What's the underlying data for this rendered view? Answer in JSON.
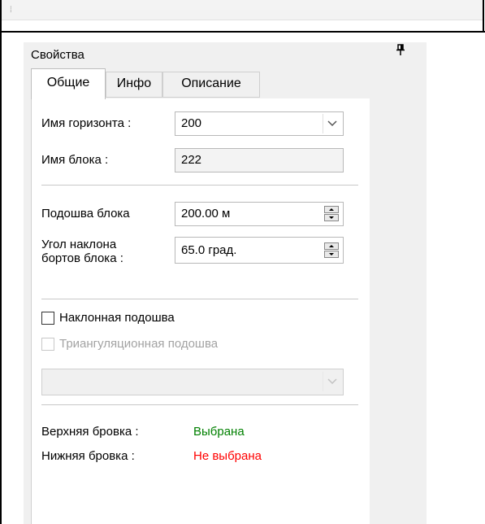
{
  "panel": {
    "title": "Свойства",
    "pin_icon": "pin-icon"
  },
  "tabs": [
    {
      "label": "Общие",
      "active": true
    },
    {
      "label": "Инфо",
      "active": false
    },
    {
      "label": "Описание",
      "active": false
    }
  ],
  "general": {
    "horizon_label": "Имя горизонта :",
    "horizon_value": "200",
    "block_label": "Имя блока :",
    "block_value": "222",
    "sole_label": "Подошва блока",
    "sole_value": "200.00 м",
    "slope_label_line1": "Угол наклона",
    "slope_label_line2": "бортов блока :",
    "slope_value": "65.0 град.",
    "inclined_label": "Наклонная подошва",
    "inclined_checked": false,
    "triang_label": "Триангуляционная  подошва",
    "triang_checked": false,
    "triang_enabled": false,
    "surface_select_value": "",
    "upper_edge_label": "Верхняя бровка :",
    "upper_edge_status": "Выбрана",
    "lower_edge_label": "Нижняя бровка :",
    "lower_edge_status": "Не выбрана"
  },
  "colors": {
    "selected": "#008000",
    "not_selected": "#ff0000"
  }
}
